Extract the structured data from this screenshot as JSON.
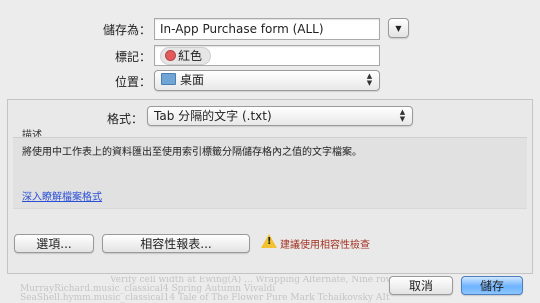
{
  "save_as": {
    "label": "儲存為：",
    "value": "In-App Purchase form (ALL)"
  },
  "tags": {
    "label": "標記：",
    "tag_name": "紅色",
    "tag_color": "#e25b5b"
  },
  "where": {
    "label": "位置：",
    "value": "桌面",
    "icon": "folder-icon"
  },
  "format": {
    "label": "格式：",
    "value": "Tab 分隔的文字 (.txt)"
  },
  "description": {
    "heading": "描述",
    "text": "將使用中工作表上的資料匯出至使用索引標籤分隔儲存格內之值的文字檔案。",
    "link": "深入瞭解檔案格式",
    "link_color": "#2a4fd6"
  },
  "buttons": {
    "options": "選項...",
    "compatibility_report": "相容性報表...",
    "cancel": "取消",
    "save": "儲存"
  },
  "warning": {
    "text": "建議使用相容性檢查",
    "icon": "warning-icon",
    "color": "#a33222"
  },
  "background_text": [
    "Verify cell width at Ewing(A) ...  Wrapping Alternate, Nine rows chart ...",
    "MurrayRichard.music_classical4   Spring  Autumn Vivaldi",
    "SeaShell.hymm.music_classical14   Tale of The Flower  Pure Mark Tchaikovsky  AIt"
  ]
}
